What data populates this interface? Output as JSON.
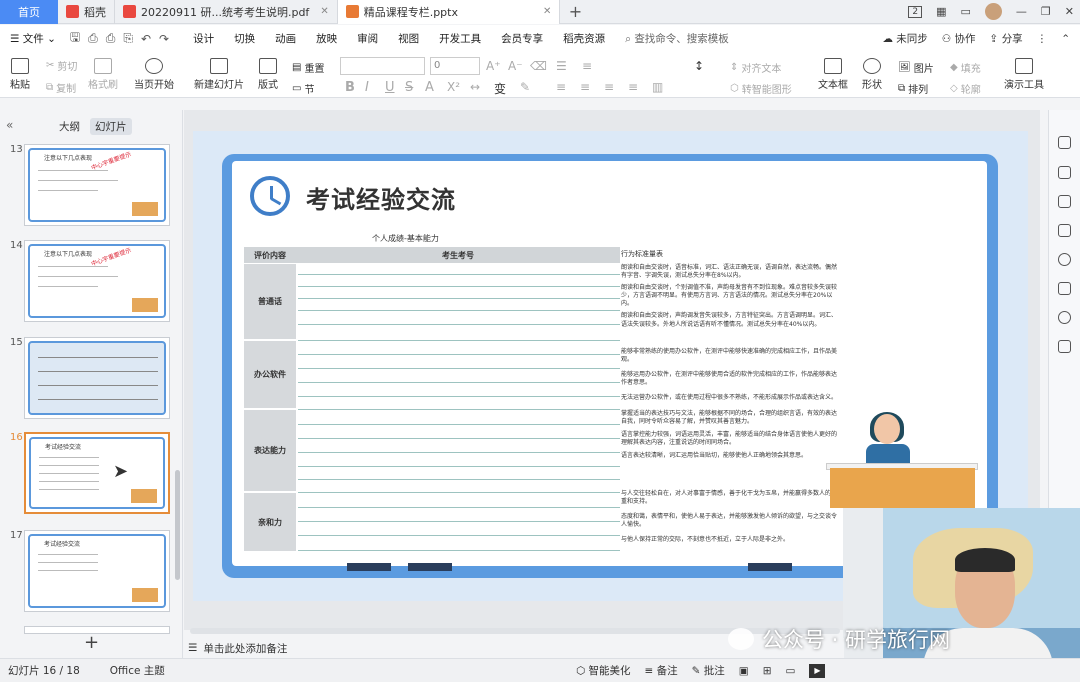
{
  "tabs": {
    "home": "首页",
    "items": [
      {
        "label": "稻壳",
        "icon_color": "#e9483f",
        "active": false
      },
      {
        "label": "20220911 研...统考考生说明.pdf",
        "icon_color": "#e9483f",
        "active": false
      },
      {
        "label": "精品课程专栏.pptx",
        "icon_color": "#e87a35",
        "active": true
      }
    ],
    "add": "+"
  },
  "window_controls": {
    "badge": "2",
    "minimize": "—",
    "restore": "❐",
    "close": "✕"
  },
  "menu": {
    "file": "文件",
    "items": [
      "设计",
      "切换",
      "动画",
      "放映",
      "审阅",
      "视图",
      "开发工具",
      "会员专享",
      "稻壳资源"
    ],
    "search_placeholder": "查找命令、搜索模板",
    "unsynced": "未同步",
    "collab": "协作",
    "share": "分享"
  },
  "ribbon": {
    "paste": "粘贴",
    "cut": "剪切",
    "copy": "复制",
    "format_painter": "格式刷",
    "from_start": "当页开始",
    "new_slide": "新建幻灯片",
    "layout": "版式",
    "section": "节",
    "reset": "重置",
    "font_size": "0",
    "bold": "B",
    "italic": "I",
    "underline": "U",
    "strike": "S",
    "text_box": "文本框",
    "shape": "形状",
    "arrange": "排列",
    "picture": "图片",
    "fill": "填充",
    "outline": "轮廓",
    "align_text": "对齐文本",
    "smart_graphic": "转智能图形",
    "presenter_tools": "演示工具"
  },
  "left_panel": {
    "outline_tab": "大纲",
    "slides_tab": "幻灯片",
    "thumbs": [
      {
        "num": "13",
        "title": "注意以下几点表现",
        "stamp": "中心字重要提示"
      },
      {
        "num": "14",
        "title": "注意以下几点表现",
        "stamp": "中心字重要提示"
      },
      {
        "num": "15",
        "title": ""
      },
      {
        "num": "16",
        "title": "考试经验交流"
      },
      {
        "num": "17",
        "title": "考试经验交流"
      }
    ],
    "selected": "16",
    "add": "+"
  },
  "slide": {
    "title": "考试经验交流",
    "subtitle": "个人成绩-基本能力",
    "col_eval": "评价内容",
    "col_candidate": "考生考号",
    "rubric_header": "行为标准量表",
    "categories": [
      "普通话",
      "办公软件",
      "表达能力",
      "亲和力"
    ],
    "rubric": {
      "mandarin": [
        "朗读和自由交谈时，语音标准，词汇、语法正确无误，语调自然，表达流畅。偶然有字音、字调失误，测试总失分率在8%以内。",
        "朗读和自由交谈时，个别调值不准，声韵母发音有不到位现象。难点音较多失误较少，方言语调不明显。有使用方言词、方言语法的情况。测试总失分率在20%以内。",
        "朗读和自由交谈时，声韵调发音失误较多，方言特征突出。方言语调明显。词汇、语法失误较多。外地人所说话语有听不懂情况。测试总失分率在40%以内。"
      ],
      "office": [
        "能够非常熟练的使用办公软件，在测评中能够快速准确的完成相应工作，且作品美观。",
        "能够运用办公软件，在测评中能够使用合适的软件完成相应的工作，作品能够表达作者意思。",
        "无法运营办公软件，或在使用过程中很多不熟练，不能形成展示作品或表达含义。"
      ],
      "expression": [
        "掌握适当的表达技巧与文法，能够根据不同的场合，合理的组织言语，有效的表达自我，同时令听众容易了解，并赞叹其善言魅力。",
        "语言掌控能力较强，词语运用灵活，丰富，能够适当的结合身体语言使他人更好的理解其表达内容，注重说话的时间同场合。",
        "语言表达较清晰，词汇运用恰当贴切，能够使他人正确地领会其意思。"
      ],
      "affinity": [
        "与人交往轻松自在，对人对事富于情感，善于化干戈为玉帛，并能赢得多数人的尊重和支持。",
        "态度和蔼，表情平和，使他人易于表达，并能够激发他人倾诉的欲望，与之交谈令人愉快。",
        "与他人保持正常的交际，不刻意也不抵近，立于人际是非之外。"
      ]
    }
  },
  "notes_placeholder": "单击此处添加备注",
  "status": {
    "slide_counter": "幻灯片 16 / 18",
    "theme": "Office 主题",
    "smart_beautify": "智能美化",
    "notes": "备注",
    "comments": "批注"
  },
  "watermark": "公众号 · 研学旅行网",
  "colors": {
    "accent": "#4b8bf4",
    "slide_frame": "#5b9be0",
    "selected_thumb": "#e58c39"
  }
}
